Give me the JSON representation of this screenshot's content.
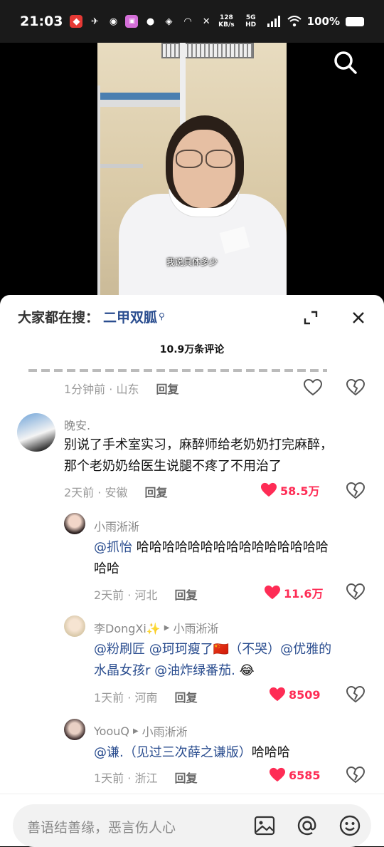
{
  "status_bar": {
    "time": "21:03",
    "net_speed_value": "128",
    "net_speed_unit": "KB/s",
    "network": "5G HD",
    "battery": "100%"
  },
  "video": {
    "caption": "我说具体多少"
  },
  "sheet": {
    "hot_label": "大家都在搜：",
    "hot_term": "二甲双胍",
    "comment_count": "10.9万条评论"
  },
  "comments": [
    {
      "time": "1分钟前",
      "location": "山东",
      "reply_label": "回复"
    },
    {
      "username": "晚安.",
      "line1": "别说了手术室实习，麻醉师给老奶奶打完麻醉，",
      "line2": "那个老奶奶给医生说腿不疼了不用治了",
      "time": "2天前",
      "location": "安徽",
      "reply_label": "回复",
      "likes": "58.5万"
    },
    {
      "username": "小雨淅淅",
      "mention": "@抓怡",
      "line1": " 哈哈哈哈哈哈哈哈哈哈哈哈哈哈哈",
      "line2": "哈哈",
      "time": "2天前",
      "location": "河北",
      "reply_label": "回复",
      "likes": "11.6万"
    },
    {
      "username": "李DongXi✨",
      "reply_to": "小雨淅淅",
      "mention1": "@粉刷匠",
      "mention2": " @珂珂瘦了🇨🇳（不哭）@优雅的",
      "mention3": "水晶女孩r",
      "mention4": " @油炸绿番茄.",
      "emoji": " 😂",
      "time": "1天前",
      "location": "河南",
      "reply_label": "回复",
      "likes": "8509"
    },
    {
      "username": "YoouQ",
      "reply_to": "小雨淅淅",
      "mention": "@谦.（见过三次薛之谦版）",
      "text": "哈哈哈",
      "time": "1天前",
      "location": "浙江",
      "reply_label": "回复",
      "likes": "6585"
    }
  ],
  "input": {
    "placeholder": "善语结善缘，恶言伤人心"
  },
  "colors": {
    "accent_like": "#fe2c55",
    "mention": "#2a4d8f"
  }
}
